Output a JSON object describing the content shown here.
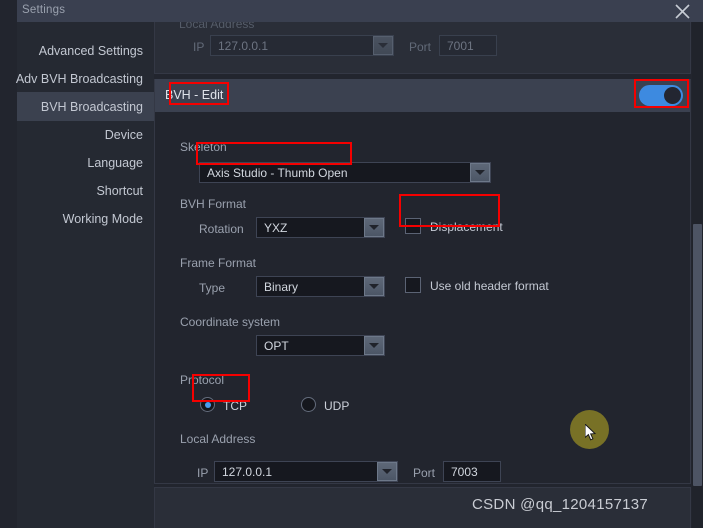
{
  "window": {
    "title": "Settings",
    "close_icon": "close-icon"
  },
  "sidebar": {
    "items": [
      {
        "label": "Advanced Settings",
        "active": false
      },
      {
        "label": "Adv BVH Broadcasting",
        "active": false
      },
      {
        "label": "BVH Broadcasting",
        "active": true
      },
      {
        "label": "Device",
        "active": false
      },
      {
        "label": "Language",
        "active": false
      },
      {
        "label": "Shortcut",
        "active": false
      },
      {
        "label": "Working Mode",
        "active": false
      }
    ]
  },
  "top_section": {
    "group_label": "Local Address",
    "ip_label": "IP",
    "ip_value": "127.0.0.1",
    "port_label": "Port",
    "port_value": "7001",
    "dropdown_icon": "chevron-down-icon"
  },
  "bvh_edit": {
    "title": "BVH - Edit",
    "toggle_on": true,
    "toggle_accent": "#3d8ae0"
  },
  "skeleton": {
    "label": "Skeleton",
    "value": "Axis Studio - Thumb Open",
    "dropdown_icon": "chevron-down-icon"
  },
  "bvh_format": {
    "label": "BVH Format",
    "rotation_label": "Rotation",
    "rotation_value": "YXZ",
    "displacement_label": "Displacement",
    "displacement_checked": false
  },
  "frame_format": {
    "label": "Frame Format",
    "type_label": "Type",
    "type_value": "Binary",
    "old_header_label": "Use old header format",
    "old_header_checked": false
  },
  "coordinate_system": {
    "label": "Coordinate system",
    "value": "OPT"
  },
  "protocol": {
    "label": "Protocol",
    "options": [
      {
        "label": "TCP",
        "selected": true
      },
      {
        "label": "UDP",
        "selected": false
      }
    ]
  },
  "local_address": {
    "label": "Local Address",
    "ip_label": "IP",
    "ip_value": "127.0.0.1",
    "port_label": "Port",
    "port_value": "7003"
  },
  "annotations": {
    "color": "#f50000",
    "boxes": [
      "bvh-edit-title",
      "toggle",
      "skeleton-value",
      "displacement-checkbox",
      "tcp-radio"
    ]
  },
  "watermark": {
    "text": "CSDN @qq_1204157137"
  }
}
